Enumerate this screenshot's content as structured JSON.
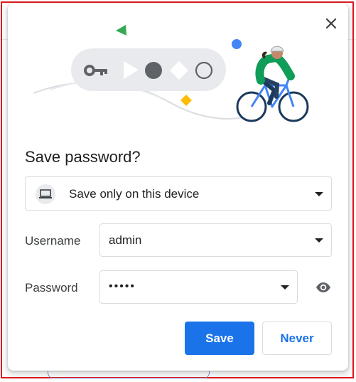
{
  "dialog": {
    "title": "Save password?",
    "storage": {
      "label": "Save only on this device",
      "icon": "laptop-icon"
    },
    "username": {
      "label": "Username",
      "value": "admin"
    },
    "password": {
      "label": "Password",
      "value": "•••••"
    },
    "buttons": {
      "save": "Save",
      "never": "Never"
    },
    "icons": {
      "close": "close-icon",
      "eye": "eye-icon",
      "key": "key-icon",
      "cyclist": "cyclist-illustration"
    }
  },
  "colors": {
    "accent": "#1a73e8",
    "frame": "#e0181d",
    "text": "#202124",
    "border": "#dadce0",
    "green": "#34a853",
    "yellow": "#fbbc04",
    "blue_dot": "#4285f4"
  }
}
